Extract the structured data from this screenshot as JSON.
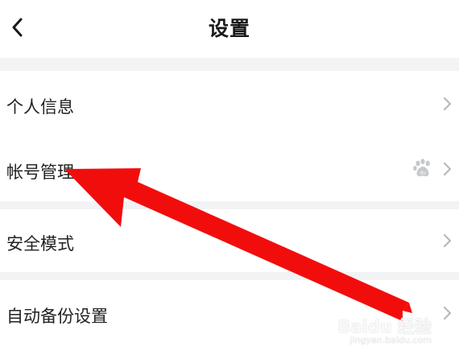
{
  "header": {
    "title": "设置",
    "back_icon": "chevron-left-icon"
  },
  "settings": {
    "items": [
      {
        "label": "个人信息",
        "icon": "chevron-right-icon"
      },
      {
        "label": "帐号管理",
        "account_icon": "baidu-paw-icon",
        "icon": "chevron-right-icon"
      },
      {
        "label": "安全模式",
        "icon": "chevron-right-icon"
      },
      {
        "label": "自动备份设置",
        "icon": "chevron-right-icon"
      }
    ]
  },
  "watermark": {
    "main": "Baidu 经验",
    "sub": "jingyan.baidu.com"
  },
  "colors": {
    "background": "#ffffff",
    "divider": "#f2f3f5",
    "chevron": "#b7b9bd",
    "arrow": "#f20d0d",
    "paw_icon": "#c6c8cc"
  }
}
